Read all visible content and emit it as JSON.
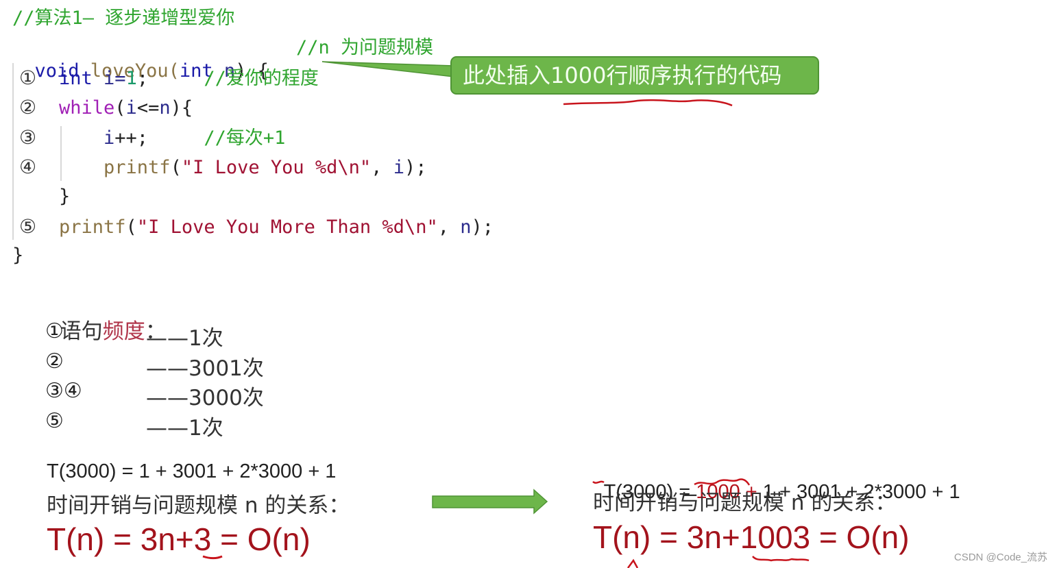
{
  "code": {
    "header_comment": "//算法1— 逐步递增型爱你",
    "signature": {
      "kw": "void",
      "name": " loveYou(",
      "param_type": "int",
      "param": " n",
      "rest": ") {",
      "comment": "//n 为问题规模"
    },
    "lines": [
      {
        "marker": "①",
        "parts": [
          {
            "t": "int",
            "c": "kw"
          },
          {
            "t": " i=",
            "c": "var"
          },
          {
            "t": "1",
            "c": "num"
          },
          {
            "t": ";",
            "c": "punc"
          },
          {
            "t": "     //爱你的程度",
            "c": "cmt"
          }
        ]
      },
      {
        "marker": "②",
        "parts": [
          {
            "t": "while",
            "c": "kw-while"
          },
          {
            "t": "(",
            "c": "punc"
          },
          {
            "t": "i",
            "c": "var"
          },
          {
            "t": "<=",
            "c": "punc"
          },
          {
            "t": "n",
            "c": "var"
          },
          {
            "t": "){",
            "c": "punc"
          }
        ]
      },
      {
        "marker": "③",
        "parts": [
          {
            "t": "    i",
            "c": "var"
          },
          {
            "t": "++;",
            "c": "punc"
          },
          {
            "t": "     //每次+1",
            "c": "cmt"
          }
        ]
      },
      {
        "marker": "④",
        "parts": [
          {
            "t": "    printf",
            "c": "fn"
          },
          {
            "t": "(",
            "c": "punc"
          },
          {
            "t": "\"I Love You %d\\n\"",
            "c": "str"
          },
          {
            "t": ", ",
            "c": "punc"
          },
          {
            "t": "i",
            "c": "var"
          },
          {
            "t": ");",
            "c": "punc"
          }
        ]
      },
      {
        "marker": "",
        "parts": [
          {
            "t": "}",
            "c": "punc"
          }
        ]
      },
      {
        "marker": "⑤",
        "parts": [
          {
            "t": "printf",
            "c": "fn"
          },
          {
            "t": "(",
            "c": "punc"
          },
          {
            "t": "\"I Love You More Than %d\\n\"",
            "c": "str"
          },
          {
            "t": ", ",
            "c": "punc"
          },
          {
            "t": "n",
            "c": "var"
          },
          {
            "t": ");",
            "c": "punc"
          }
        ]
      }
    ],
    "closing_brace": "}"
  },
  "callout": {
    "text": "此处插入1000行顺序执行的代码",
    "color": "#6db64a"
  },
  "frequency": {
    "title_prefix": "语句",
    "title_highlight": "频度",
    "title_suffix": "：",
    "rows": [
      {
        "marker": "①",
        "count": "——1次"
      },
      {
        "marker": "②",
        "count": "——3001次"
      },
      {
        "marker": "③④",
        "count": "——3000次"
      },
      {
        "marker": "⑤",
        "count": "——1次"
      }
    ]
  },
  "left_formula": {
    "t3000": "T(3000) = 1 + 3001 + 2*3000 + 1",
    "relation": "时间开销与问题规模 n 的关系：",
    "result": "T(n) = 3n+3 = O(n)"
  },
  "right_formula": {
    "t3000_prefix": "T(3000) = ",
    "t3000_added": "1000 +",
    "t3000_rest": " 1 + 3001 + 2*3000 + 1",
    "relation": "时间开销与问题规模 n 的关系：",
    "result": "T(n) = 3n+1003 = O(n)"
  },
  "watermark": "CSDN @Code_流苏"
}
